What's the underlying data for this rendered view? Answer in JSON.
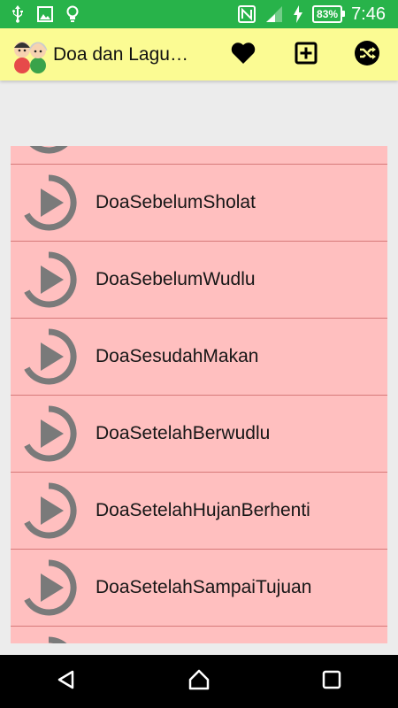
{
  "status_bar": {
    "battery_percent": "83%",
    "time": "7:46",
    "icons": [
      "usb-icon",
      "image-icon",
      "lightbulb-icon",
      "nfc-icon",
      "signal-icon",
      "charging-icon"
    ]
  },
  "app_bar": {
    "title": "Doa dan Lagu…",
    "actions": [
      "favorites-heart-icon",
      "add-box-icon",
      "shuffle-icon"
    ]
  },
  "list": {
    "items": [
      {
        "label": ""
      },
      {
        "label": "DoaSebelumSholat"
      },
      {
        "label": "DoaSebelumWudlu"
      },
      {
        "label": "DoaSesudahMakan"
      },
      {
        "label": "DoaSetelahBerwudlu"
      },
      {
        "label": "DoaSetelahHujanBerhenti"
      },
      {
        "label": "DoaSetelahSampaiTujuan"
      },
      {
        "label": ""
      }
    ],
    "item_icon": "play-circle-icon"
  },
  "nav_bar": {
    "buttons": [
      "back-icon",
      "home-icon",
      "recents-icon"
    ]
  },
  "colors": {
    "status_bar": "#28b34a",
    "app_bar": "#fbfb93",
    "list_bg": "#ffbfbf",
    "divider": "#d77a7a",
    "icon_gray": "#7a7a7a"
  }
}
